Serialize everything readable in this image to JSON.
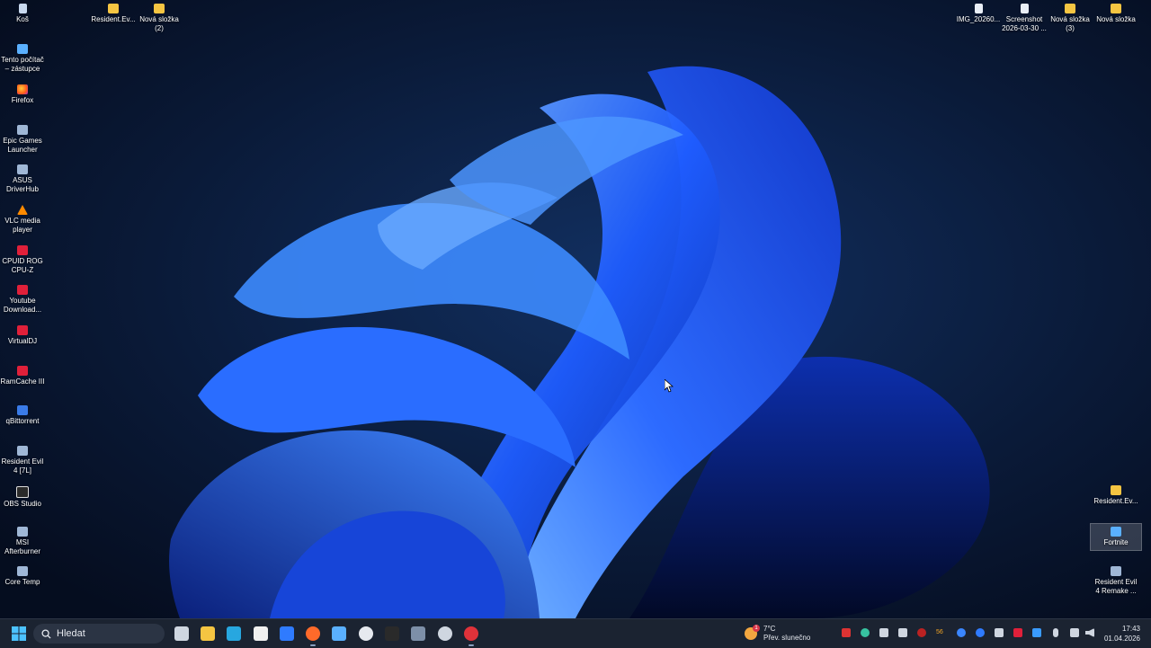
{
  "desktop": {
    "left_column": [
      {
        "label": "Koš",
        "icon": "recycle-bin-icon"
      },
      {
        "label": "Tento počítač\n– zástupce",
        "icon": "computer-icon"
      },
      {
        "label": "Firefox",
        "icon": "firefox-icon"
      },
      {
        "label": "Epic Games\nLauncher",
        "icon": "epic-games-icon"
      },
      {
        "label": "ASUS\nDriverHub",
        "icon": "asus-icon"
      },
      {
        "label": "VLC media\nplayer",
        "icon": "vlc-icon"
      },
      {
        "label": "CPUID ROG\nCPU-Z",
        "icon": "cpuz-icon"
      },
      {
        "label": "Youtube\nDownload...",
        "icon": "youtube-downloader-icon"
      },
      {
        "label": "VirtualDJ",
        "icon": "virtualdj-icon"
      },
      {
        "label": "RamCache III",
        "icon": "ramcache-icon"
      },
      {
        "label": "qBittorrent",
        "icon": "qbittorrent-icon"
      },
      {
        "label": "Resident Evil\n4 [7L]",
        "icon": "game-icon"
      },
      {
        "label": "OBS Studio",
        "icon": "obs-icon"
      },
      {
        "label": "MSI\nAfterburner",
        "icon": "afterburner-icon"
      },
      {
        "label": "Core Temp",
        "icon": "coretemp-icon"
      }
    ],
    "top_row_left": [
      {
        "label": "Resident.Ev...",
        "icon": "folder-icon"
      },
      {
        "label": "Nová složka\n(2)",
        "icon": "folder-icon"
      }
    ],
    "top_row_right": [
      {
        "label": "IMG_20260...",
        "icon": "image-file-icon"
      },
      {
        "label": "Screenshot\n2026-03-30 ...",
        "icon": "image-file-icon"
      },
      {
        "label": "Nová složka\n(3)",
        "icon": "folder-icon"
      },
      {
        "label": "Nová složka",
        "icon": "folder-icon"
      }
    ],
    "right_bottom": [
      {
        "label": "Resident.Ev...",
        "icon": "folder-icon"
      },
      {
        "label": "Fortnite",
        "icon": "fortnite-icon",
        "selected": true
      },
      {
        "label": "Resident Evil\n4 Remake ...",
        "icon": "game-icon"
      }
    ]
  },
  "taskbar": {
    "search_placeholder": "Hledat",
    "pinned": [
      "task-view-icon",
      "file-explorer-icon",
      "edge-icon",
      "store-icon",
      "mail-icon",
      "firefox-icon",
      "app-window-icon",
      "steam-icon",
      "unity-icon",
      "calculator-icon",
      "speedometer-icon",
      "chrome-icon"
    ],
    "weather": {
      "temperature": "7°C",
      "condition": "Přev. slunečno",
      "badge": "1"
    },
    "tray_badge": "56",
    "clock": {
      "time": "17:43",
      "date": "01.04.2026"
    }
  },
  "colors": {
    "accent": "#1f5bff",
    "taskbar": "#1b2331",
    "folder": "#f5c542"
  }
}
